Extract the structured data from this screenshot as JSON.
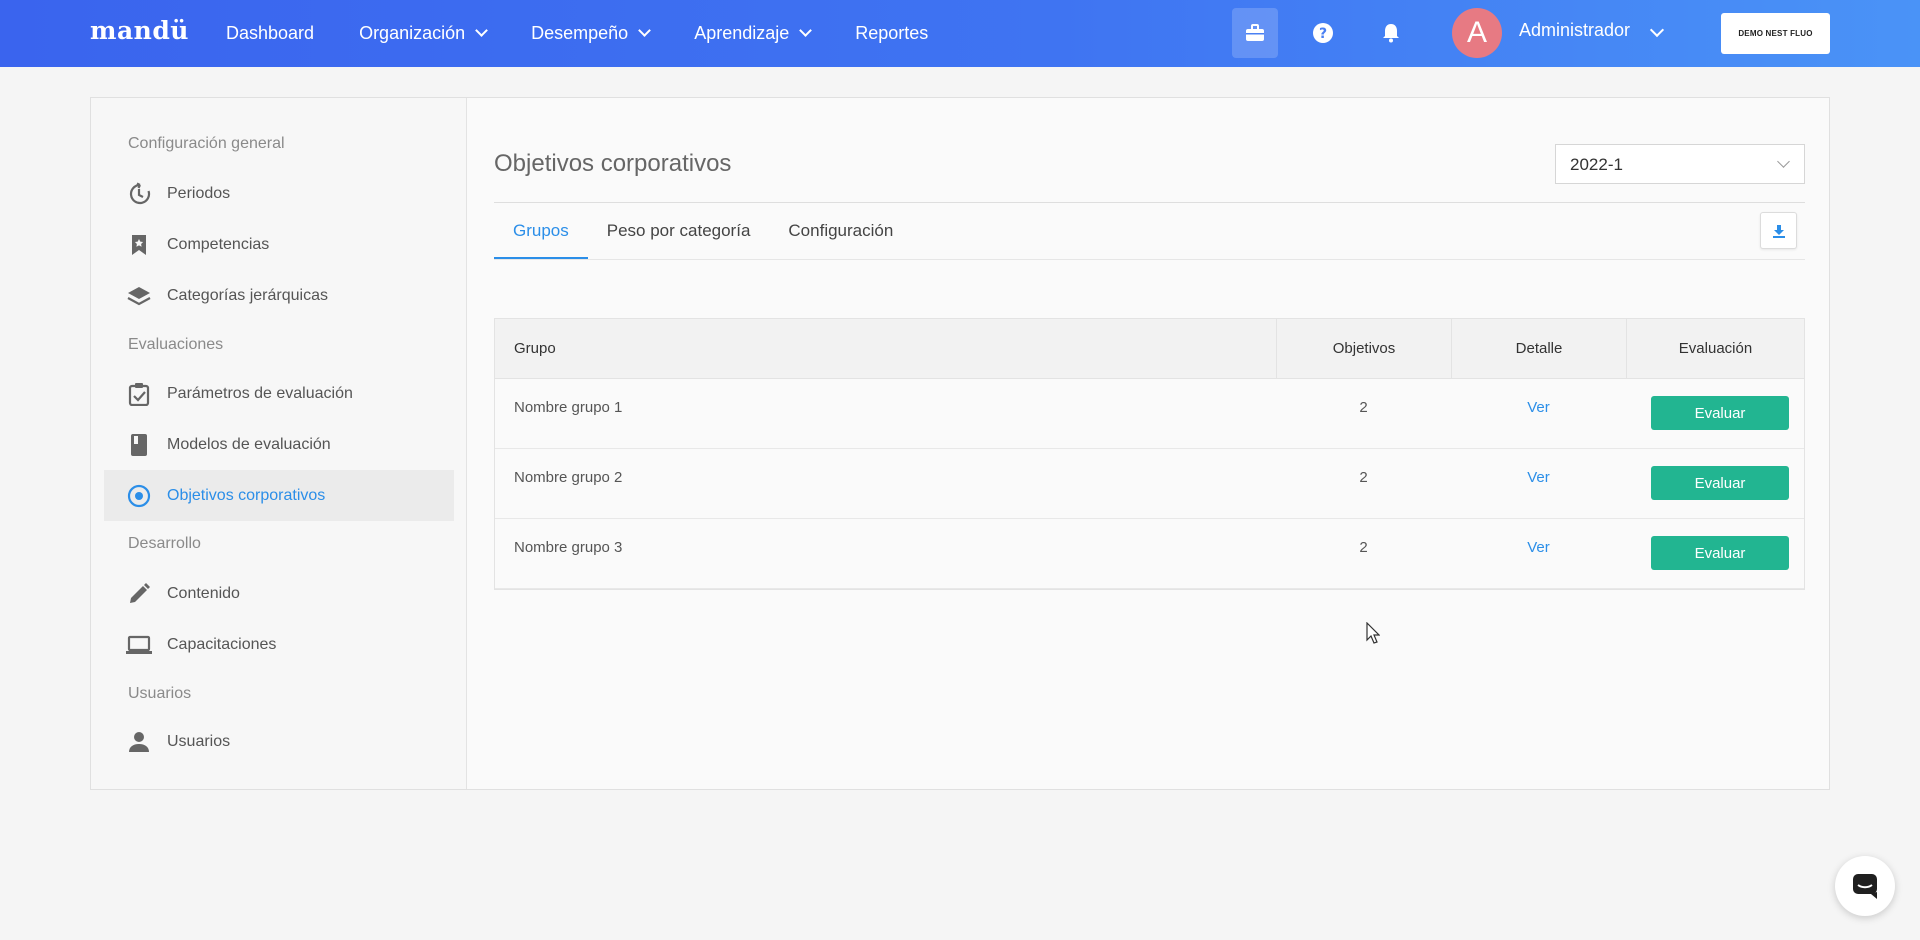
{
  "navbar": {
    "logo": "mandü",
    "links": [
      {
        "label": "Dashboard",
        "has_dropdown": false
      },
      {
        "label": "Organización",
        "has_dropdown": true
      },
      {
        "label": "Desempeño",
        "has_dropdown": true
      },
      {
        "label": "Aprendizaje",
        "has_dropdown": true
      },
      {
        "label": "Reportes",
        "has_dropdown": false
      }
    ],
    "icons": [
      "briefcase-icon",
      "help-icon",
      "bell-icon"
    ],
    "avatar_letter": "A",
    "user_name": "Administrador",
    "company_button": "DEMO NEST FLUO"
  },
  "sidebar": {
    "sections": [
      {
        "title": "Configuración general",
        "items": [
          {
            "label": "Periodos",
            "icon": "history-icon"
          },
          {
            "label": "Competencias",
            "icon": "bookmark-icon"
          },
          {
            "label": "Categorías jerárquicas",
            "icon": "layers-icon"
          }
        ]
      },
      {
        "title": "Evaluaciones",
        "items": [
          {
            "label": "Parámetros de evaluación",
            "icon": "clipboard-check-icon"
          },
          {
            "label": "Modelos de evaluación",
            "icon": "book-icon"
          },
          {
            "label": "Objetivos corporativos",
            "icon": "target-icon",
            "active": true
          }
        ]
      },
      {
        "title": "Desarrollo",
        "items": [
          {
            "label": "Contenido",
            "icon": "pencil-icon"
          },
          {
            "label": "Capacitaciones",
            "icon": "laptop-icon"
          }
        ]
      },
      {
        "title": "Usuarios",
        "items": [
          {
            "label": "Usuarios",
            "icon": "user-icon"
          }
        ]
      }
    ]
  },
  "main": {
    "title": "Objetivos corporativos",
    "period_select": "2022-1",
    "tabs": [
      {
        "label": "Grupos",
        "active": true
      },
      {
        "label": "Peso por categoría",
        "active": false
      },
      {
        "label": "Configuración",
        "active": false
      }
    ],
    "table": {
      "headers": {
        "group": "Grupo",
        "objectives": "Objetivos",
        "detail": "Detalle",
        "evaluation": "Evaluación"
      },
      "rows": [
        {
          "group": "Nombre grupo 1",
          "objectives": "2",
          "detail": "Ver",
          "action": "Evaluar"
        },
        {
          "group": "Nombre grupo 2",
          "objectives": "2",
          "detail": "Ver",
          "action": "Evaluar"
        },
        {
          "group": "Nombre grupo 3",
          "objectives": "2",
          "detail": "Ver",
          "action": "Evaluar"
        }
      ]
    }
  },
  "colors": {
    "nav_gradient_start": "#3a64ee",
    "nav_gradient_end": "#4a93f7",
    "accent": "#2b8ee8",
    "evaluate_button": "#22b591"
  }
}
